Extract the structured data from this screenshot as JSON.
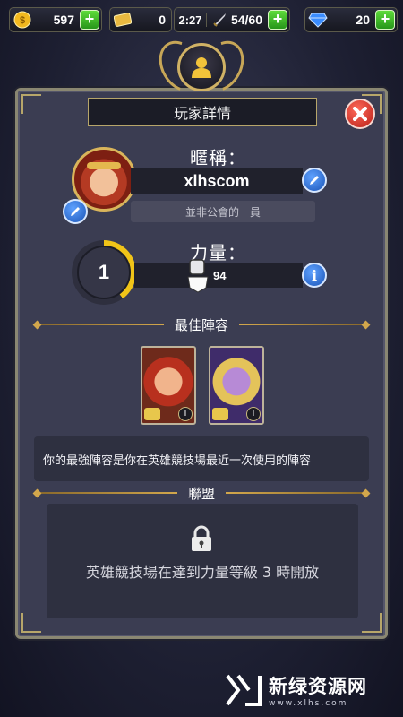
{
  "resources": {
    "gold": "597",
    "tickets": "0",
    "timer": "2:27",
    "energy": "54/60",
    "gems": "20"
  },
  "dialog": {
    "title": "玩家詳情",
    "nickname_label": "暱稱：",
    "nickname": "xlhscom",
    "guild_status": "並非公會的一員",
    "level": "1",
    "power_label": "力量：",
    "power_value": "94",
    "best_team_title": "最佳陣容",
    "best_team_info": "你的最強陣容是你在英雄競技場最近一次使用的陣容",
    "alliance_title": "聯盟",
    "alliance_locked_text": "英雄競技場在達到力量等級 3 時開放",
    "hero_level_badges": [
      "I",
      "I"
    ]
  },
  "watermark": {
    "title": "新绿资源网",
    "url": "www.xlhs.com"
  },
  "colors": {
    "gold_accent": "#d2a74c",
    "close_red": "#c7271d",
    "info_blue": "#2a6ad6",
    "plus_green": "#3dbb25"
  }
}
